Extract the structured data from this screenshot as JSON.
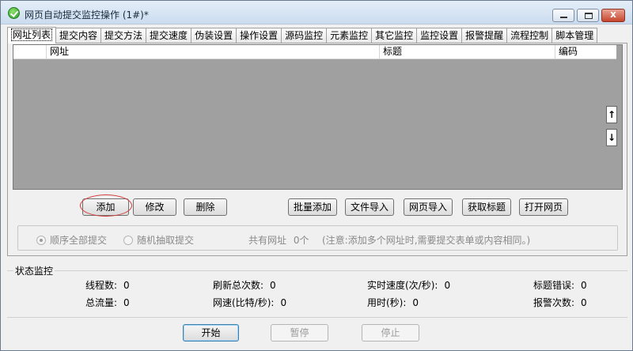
{
  "window": {
    "title": "网页自动提交监控操作  (1#)*",
    "minimize": "minimize",
    "maximize": "maximize",
    "close": "x"
  },
  "tabs": [
    {
      "label": "网址列表",
      "active": true
    },
    {
      "label": "提交内容"
    },
    {
      "label": "提交方法"
    },
    {
      "label": "提交速度"
    },
    {
      "label": "伪装设置"
    },
    {
      "label": "操作设置"
    },
    {
      "label": "源码监控"
    },
    {
      "label": "元素监控"
    },
    {
      "label": "其它监控"
    },
    {
      "label": "监控设置"
    },
    {
      "label": "报警提醒"
    },
    {
      "label": "流程控制"
    },
    {
      "label": "脚本管理"
    }
  ],
  "url_list": {
    "columns": [
      "",
      "网址",
      "标题",
      "编码"
    ],
    "rows": [],
    "move_up": "↑",
    "move_down": "↓"
  },
  "actions": {
    "add": "添加",
    "edit": "修改",
    "delete": "删除",
    "batch_add": "批量添加",
    "import_file": "文件导入",
    "import_web": "网页导入",
    "fetch_title": "获取标题",
    "open_page": "打开网页"
  },
  "submit_mode": {
    "sequential": "顺序全部提交",
    "random": "随机抽取提交",
    "selected": "sequential",
    "count_label": "共有网址",
    "count_value": "0个",
    "hint": "(注意:添加多个网址时,需要提交表单或内容相同。)"
  },
  "status": {
    "title": "状态监控",
    "items": [
      {
        "label": "线程数:",
        "value": "0"
      },
      {
        "label": "刷新总次数:",
        "value": "0"
      },
      {
        "label": "实时速度(次/秒):",
        "value": "0"
      },
      {
        "label": "标题错误:",
        "value": "0"
      },
      {
        "label": "总流量:",
        "value": "0"
      },
      {
        "label": "网速(比特/秒):",
        "value": "0"
      },
      {
        "label": "用时(秒):",
        "value": "0"
      },
      {
        "label": "报警次数:",
        "value": "0"
      }
    ]
  },
  "controls": {
    "start": "开始",
    "pause": "暂停",
    "stop": "停止"
  },
  "colors": {
    "list_background": "#a0a0a0",
    "highlight_ring": "#d23b3b"
  }
}
